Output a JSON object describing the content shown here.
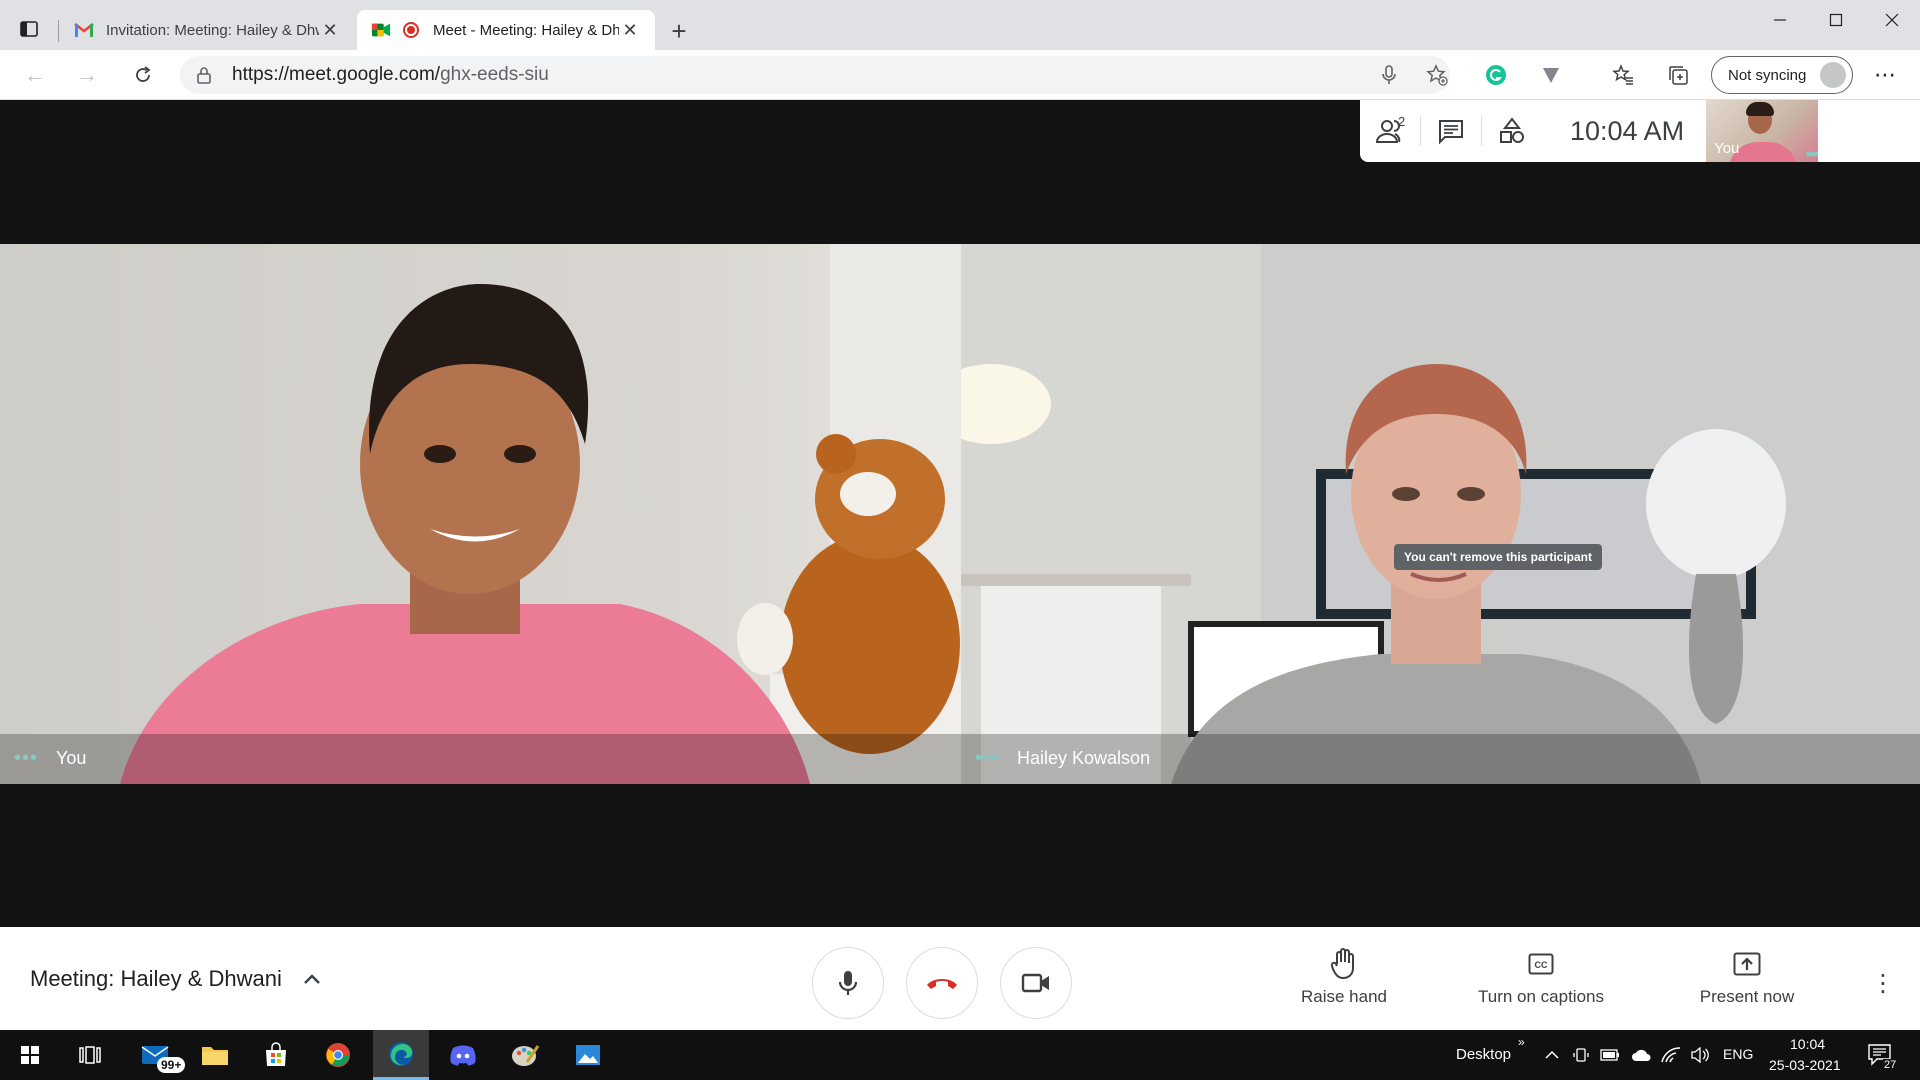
{
  "browser": {
    "tabs": [
      {
        "title": "Invitation: Meeting: Hailey & Dhwani",
        "active": false,
        "icon": "gmail-icon"
      },
      {
        "title": "Meet - Meeting: Hailey & Dhwani",
        "active": true,
        "icon": "google-meet-icon"
      }
    ],
    "url_host": "https://meet.google.com/",
    "url_path": "ghx-eeds-siu",
    "sync_label": "Not syncing",
    "colors": {
      "tabstrip": "#dfe1e5",
      "omnibox": "#f1f3f4"
    }
  },
  "meet": {
    "participant_count": "2",
    "clock": "10:04  AM",
    "self_thumb_label": "You",
    "tiles": [
      {
        "name": "You"
      },
      {
        "name": "Hailey Kowalson"
      }
    ],
    "tooltip": "You can't remove this participant",
    "meeting_title": "Meeting: Hailey & Dhwani",
    "actions": {
      "raise_hand": "Raise hand",
      "captions": "Turn on captions",
      "present": "Present now"
    },
    "colors": {
      "end_call": "#d93025",
      "accent_dots": "#80cbc4",
      "stage_bg": "#121212"
    }
  },
  "taskbar": {
    "mail_badge": "99+",
    "desktop_label": "Desktop",
    "language": "ENG",
    "time": "10:04",
    "date": "25-03-2021",
    "notifications": "27"
  }
}
